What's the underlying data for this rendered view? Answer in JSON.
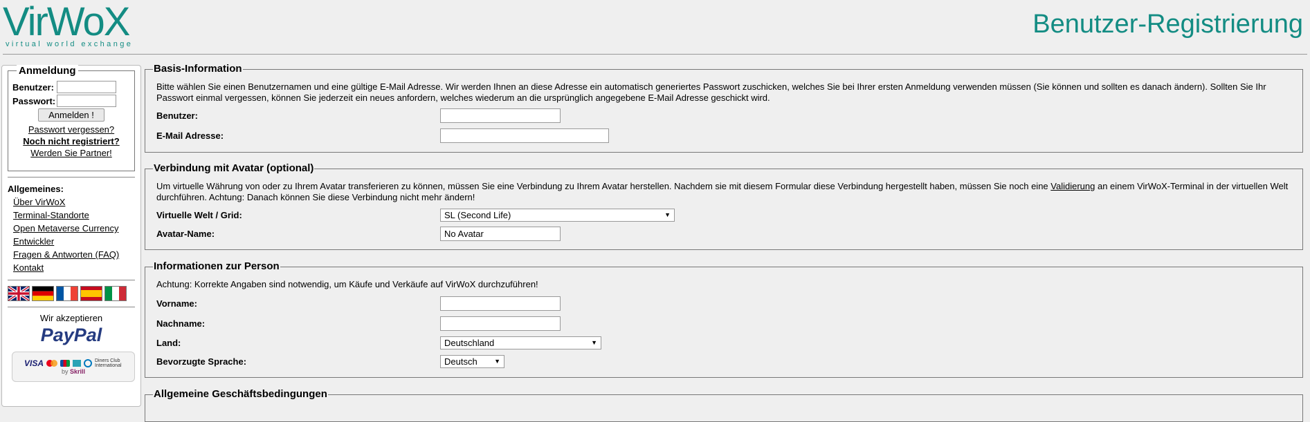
{
  "header": {
    "logo_main": "VirWoX",
    "logo_sub": "virtual world exchange",
    "title": "Benutzer-Registrierung"
  },
  "colors": {
    "brand": "#138c83"
  },
  "sidebar": {
    "login": {
      "legend": "Anmeldung",
      "user_label": "Benutzer:",
      "pass_label": "Passwort:",
      "button": "Anmelden !",
      "forgot": "Passwort vergessen?",
      "not_registered": "Noch nicht registriert?",
      "partner": "Werden Sie Partner!"
    },
    "general_label": "Allgemeines:",
    "links": [
      "Über VirWoX",
      "Terminal-Standorte",
      "Open Metaverse Currency",
      "Entwickler",
      "Fragen & Antworten (FAQ)",
      "Kontakt"
    ],
    "flags": [
      "uk-flag-icon",
      "de-flag-icon",
      "fr-flag-icon",
      "es-flag-icon",
      "it-flag-icon"
    ],
    "accept_label": "Wir akzeptieren",
    "paypal": "PayPal",
    "cards": {
      "visa": "VISA",
      "diners": "Diners Club International",
      "skrill_by": "by",
      "skrill": "Skrill"
    }
  },
  "basis": {
    "legend": "Basis-Information",
    "text": "Bitte wählen Sie einen Benutzernamen und eine gültige E-Mail Adresse. Wir werden Ihnen an diese Adresse ein automatisch generiertes Passwort zuschicken, welches Sie bei Ihrer ersten Anmeldung verwenden müssen (Sie können und sollten es danach ändern). Sollten Sie Ihr Passwort einmal vergessen, können Sie jederzeit ein neues anfordern, welches wiederum an die ursprünglich angegebene E-Mail Adresse geschickt wird.",
    "user_label": "Benutzer:",
    "user_value": "",
    "email_label": "E-Mail Adresse:",
    "email_value": ""
  },
  "avatar": {
    "legend": "Verbindung mit Avatar (optional)",
    "text_pre": "Um virtuelle Währung von oder zu Ihrem Avatar transferieren zu können, müssen Sie eine Verbindung zu Ihrem Avatar herstellen. Nachdem sie mit diesem Formular diese Verbindung hergestellt haben, müssen Sie noch eine ",
    "text_link": "Validierung",
    "text_post": " an einem VirWoX-Terminal in der virtuellen Welt durchführen. Achtung: Danach können Sie diese Verbindung nicht mehr ändern!",
    "world_label": "Virtuelle Welt / Grid:",
    "world_value": "SL (Second Life)",
    "name_label": "Avatar-Name:",
    "name_value": "No Avatar"
  },
  "person": {
    "legend": "Informationen zur Person",
    "text": "Achtung: Korrekte Angaben sind notwendig, um Käufe und Verkäufe auf VirWoX durchzuführen!",
    "first_label": "Vorname:",
    "first_value": "",
    "last_label": "Nachname:",
    "last_value": "",
    "country_label": "Land:",
    "country_value": "Deutschland",
    "lang_label": "Bevorzugte Sprache:",
    "lang_value": "Deutsch"
  },
  "agb": {
    "legend": "Allgemeine Geschäftsbedingungen"
  }
}
